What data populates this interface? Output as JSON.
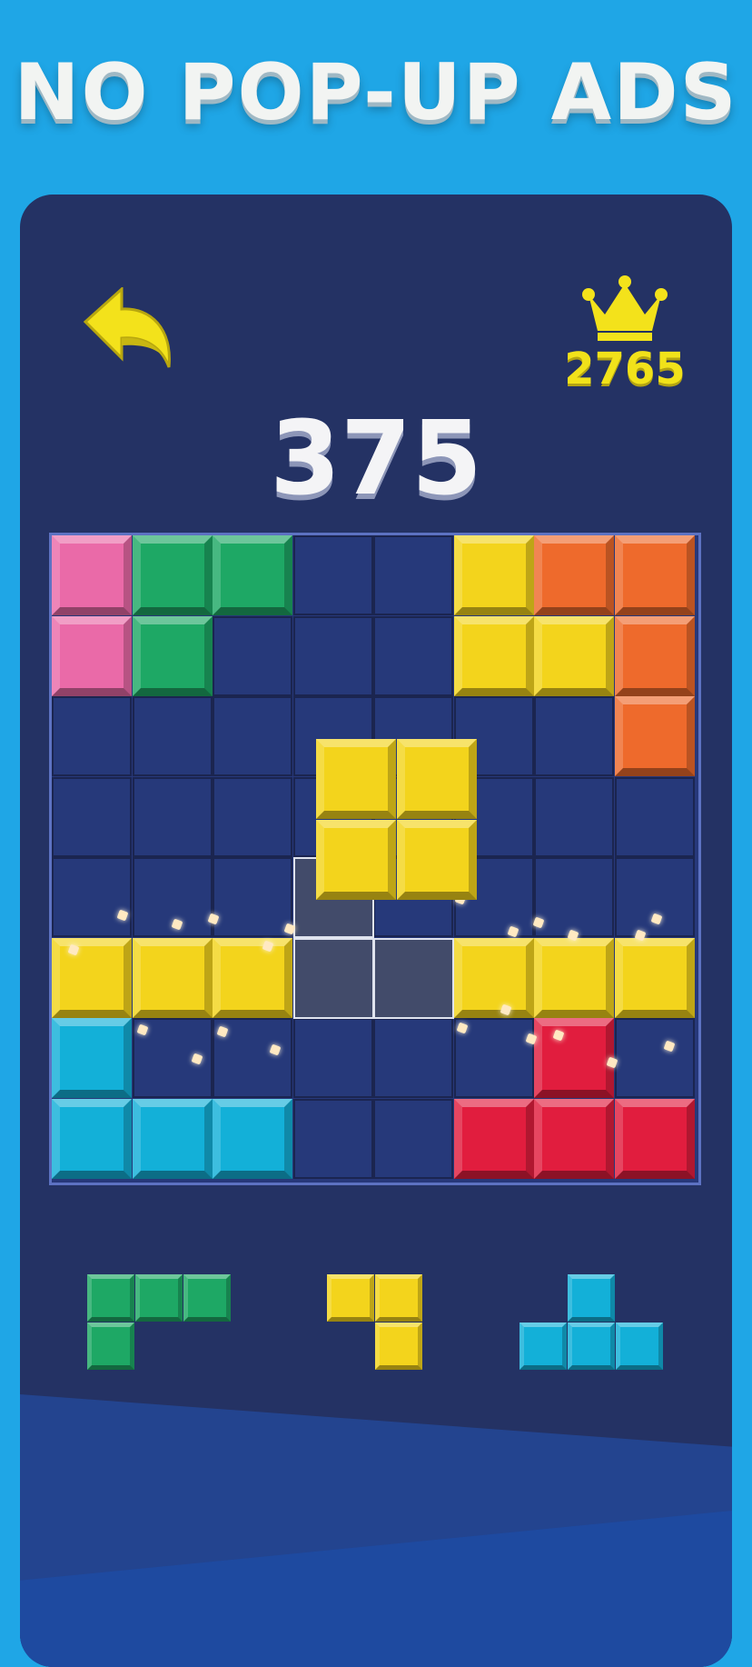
{
  "banner": {
    "text": "NO POP-UP ADS"
  },
  "header": {
    "back_icon": "back-arrow-icon",
    "crown_icon": "crown-icon",
    "best_score": "2765",
    "score": "375"
  },
  "colors": {
    "pink": "#ea6aa8",
    "green": "#1ea865",
    "yellow": "#f3d41c",
    "orange": "#ee6a2c",
    "cyan": "#13b0d8",
    "red": "#e11d3e",
    "empty": "#26397a",
    "gridline": "#1b2550",
    "accent_text": "#f1e21a"
  },
  "board": {
    "rows": 8,
    "cols": 8,
    "grid": [
      [
        "pink",
        "green",
        "green",
        "",
        "",
        "yellow",
        "orange",
        "orange"
      ],
      [
        "pink",
        "green",
        "",
        "",
        "",
        "yellow",
        "yellow",
        "orange"
      ],
      [
        "",
        "",
        "",
        "",
        "",
        "",
        "",
        "orange"
      ],
      [
        "",
        "",
        "",
        "",
        "",
        "",
        "",
        ""
      ],
      [
        "",
        "",
        "",
        "",
        "",
        "",
        "",
        ""
      ],
      [
        "yellow",
        "yellow",
        "yellow",
        "",
        "",
        "yellow",
        "yellow",
        "yellow"
      ],
      [
        "cyan",
        "",
        "",
        "",
        "",
        "",
        "red",
        ""
      ],
      [
        "cyan",
        "cyan",
        "cyan",
        "",
        "",
        "red",
        "red",
        "red"
      ]
    ],
    "ghost_cells": [
      [
        4,
        3
      ],
      [
        5,
        3
      ],
      [
        5,
        4
      ]
    ],
    "dragging_piece": {
      "color": "yellow",
      "cells": [
        [
          0,
          0
        ],
        [
          0,
          1
        ],
        [
          1,
          0
        ],
        [
          1,
          1
        ]
      ]
    }
  },
  "tray": [
    {
      "name": "green-l-piece",
      "color": "green",
      "cells": [
        [
          0,
          0
        ],
        [
          0,
          1
        ],
        [
          0,
          2
        ],
        [
          1,
          0
        ]
      ]
    },
    {
      "name": "yellow-corner-piece",
      "color": "yellow",
      "cells": [
        [
          0,
          0
        ],
        [
          0,
          1
        ],
        [
          1,
          1
        ]
      ]
    },
    {
      "name": "cyan-t-piece",
      "color": "cyan",
      "cells": [
        [
          0,
          1
        ],
        [
          1,
          0
        ],
        [
          1,
          1
        ],
        [
          1,
          2
        ]
      ]
    }
  ]
}
